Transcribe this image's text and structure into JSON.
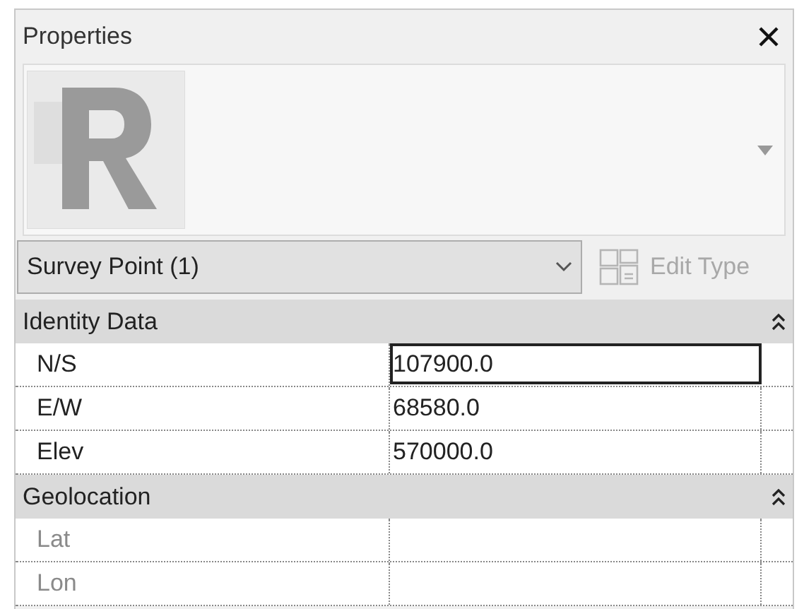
{
  "window": {
    "title": "Properties"
  },
  "type_selector": {
    "value": "Survey Point (1)"
  },
  "edit_type": {
    "label": "Edit Type",
    "disabled": true
  },
  "sections": [
    {
      "title": "Identity Data",
      "expanded": true,
      "rows": [
        {
          "label": "N/S",
          "value": "107900.0",
          "selected": true,
          "disabled": false
        },
        {
          "label": "E/W",
          "value": "68580.0",
          "selected": false,
          "disabled": false
        },
        {
          "label": "Elev",
          "value": "570000.0",
          "selected": false,
          "disabled": false
        }
      ]
    },
    {
      "title": "Geolocation",
      "expanded": true,
      "rows": [
        {
          "label": "Lat",
          "selected": false,
          "disabled": true
        },
        {
          "label": "Lon",
          "selected": false,
          "disabled": true
        }
      ]
    }
  ]
}
